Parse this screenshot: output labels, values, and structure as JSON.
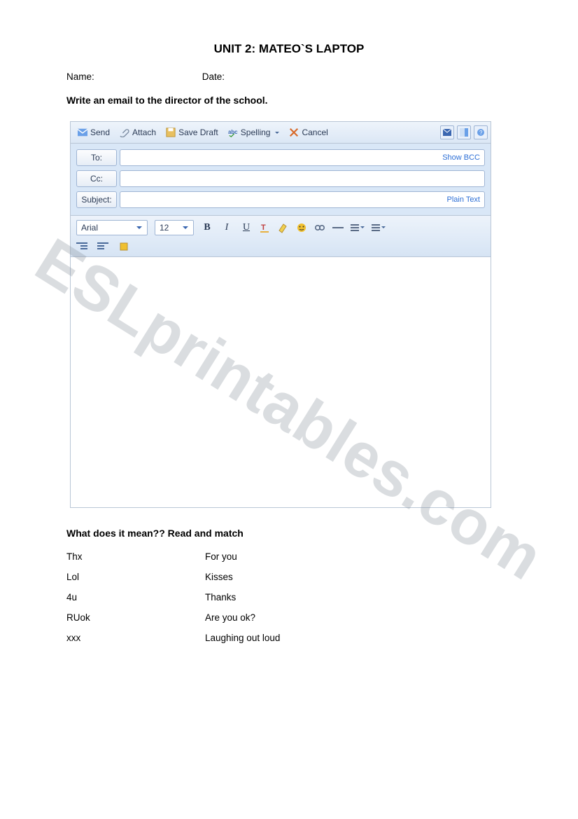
{
  "title": "UNIT 2: MATEO`S LAPTOP",
  "name_label": "Name:",
  "date_label": "Date:",
  "instruction": "Write an email to the director of the school.",
  "watermark": "ESLprintables.com",
  "composer": {
    "toolbar": {
      "send": "Send",
      "attach": "Attach",
      "save_draft": "Save Draft",
      "spelling": "Spelling",
      "cancel": "Cancel"
    },
    "fields": {
      "to_label": "To:",
      "cc_label": "Cc:",
      "subject_label": "Subject:",
      "show_bcc": "Show BCC",
      "plain_text": "Plain Text"
    },
    "format": {
      "font": "Arial",
      "size": "12",
      "bold": "B",
      "italic": "I",
      "underline": "U"
    }
  },
  "section2": {
    "heading": "What does it mean?? Read and match",
    "rows": [
      {
        "left": "Thx",
        "right": "For you"
      },
      {
        "left": "Lol",
        "right": "Kisses"
      },
      {
        "left": "4u",
        "right": "Thanks"
      },
      {
        "left": "RUok",
        "right": "Are you ok?"
      },
      {
        "left": "xxx",
        "right": "Laughing out loud"
      }
    ]
  }
}
